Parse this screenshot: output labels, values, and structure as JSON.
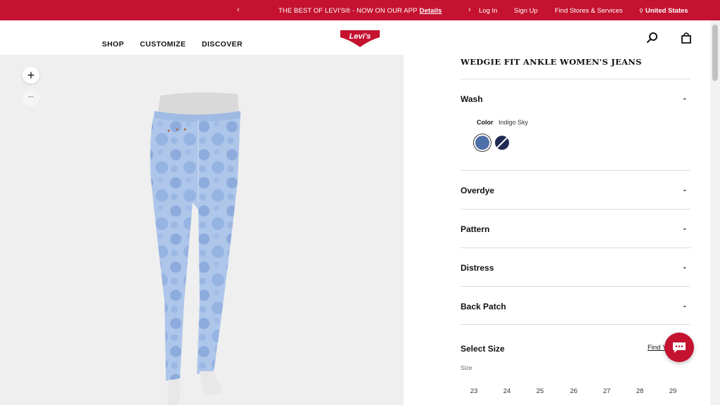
{
  "promo": {
    "prev_arrow": "‹",
    "next_arrow": "›",
    "message": "THE BEST OF LEVI'S® - NOW ON OUR APP",
    "details_link": "Details",
    "login": "Log In",
    "signup": "Sign Up",
    "find_stores": "Find Stores & Services",
    "country_pin": "⚲",
    "country": "United States",
    "bg_color": "#c41230"
  },
  "header": {
    "nav": [
      "SHOP",
      "CUSTOMIZE",
      "DISCOVER"
    ],
    "logo_text": "Levi's",
    "icons": [
      "search-icon",
      "shopping-bag-icon"
    ]
  },
  "viewer": {
    "zoom_in": "+",
    "zoom_out": "−"
  },
  "product": {
    "title": "WEDGIE FIT ANKLE WOMEN'S JEANS",
    "sections": {
      "wash": "Wash",
      "overdye": "Overdye",
      "pattern": "Pattern",
      "distress": "Distress",
      "back_patch": "Back Patch"
    },
    "chevron_up": "⌃",
    "chevron_down": "⌄",
    "color_label": "Color",
    "color_value": "Indigo Sky",
    "swatches": [
      "#4f6fa8",
      "#1e2a52"
    ],
    "select_size": "Select Size",
    "find_your_size": "Find Y",
    "size_label": "Size",
    "sizes": [
      "23",
      "24",
      "25",
      "26",
      "27",
      "28",
      "29"
    ]
  }
}
